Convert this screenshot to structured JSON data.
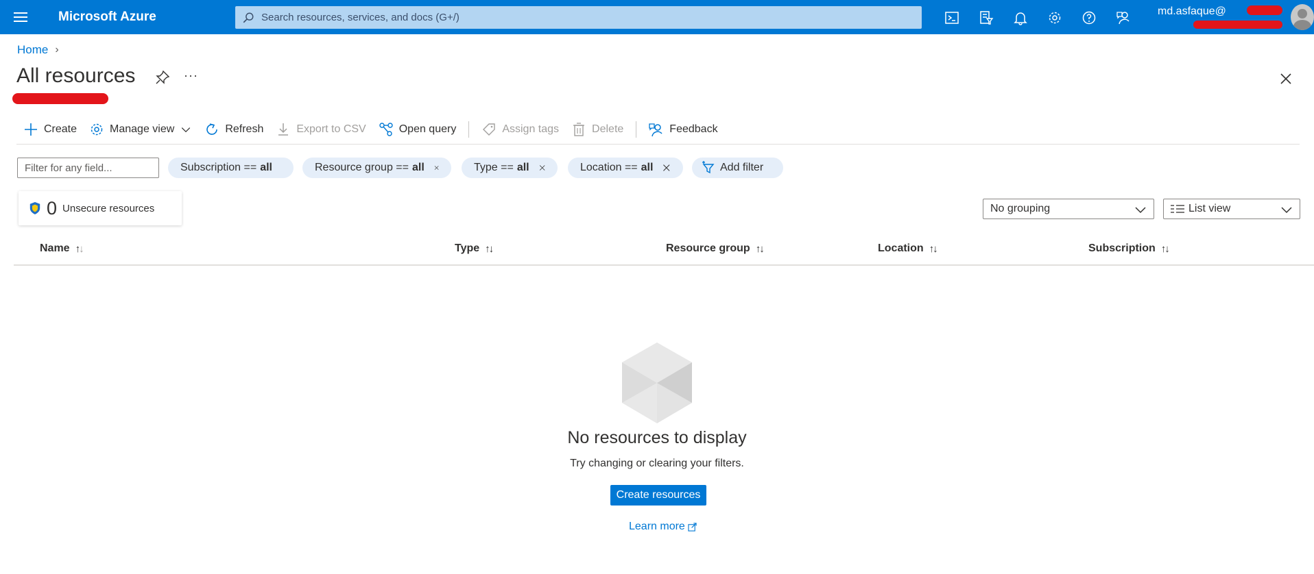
{
  "topbar": {
    "brand": "Microsoft Azure",
    "search_placeholder": "Search resources, services, and docs (G+/)",
    "user": "md.asfaque@",
    "icons": [
      "cloud-shell-icon",
      "directory-filter-icon",
      "notifications-icon",
      "settings-icon",
      "help-icon",
      "feedback-icon"
    ],
    "color": "#0078d4"
  },
  "breadcrumb": {
    "home": "Home"
  },
  "page": {
    "title": "All resources"
  },
  "toolbar": {
    "create": "Create",
    "manage_view": "Manage view",
    "refresh": "Refresh",
    "export_csv": "Export to CSV",
    "open_query": "Open query",
    "assign_tags": "Assign tags",
    "delete": "Delete",
    "feedback": "Feedback"
  },
  "filters": {
    "placeholder": "Filter for any field...",
    "subscription": {
      "label": "Subscription ==",
      "value": "all"
    },
    "resource_group": {
      "label": "Resource group ==",
      "value": "all"
    },
    "type": {
      "label": "Type ==",
      "value": "all"
    },
    "location": {
      "label": "Location ==",
      "value": "all"
    },
    "add_filter": "Add filter"
  },
  "security": {
    "count": "0",
    "label": "Unsecure resources"
  },
  "grouping": {
    "selected": "No grouping"
  },
  "view": {
    "selected": "List view"
  },
  "table": {
    "columns": [
      "Name",
      "Type",
      "Resource group",
      "Location",
      "Subscription"
    ]
  },
  "empty_state": {
    "title": "No resources to display",
    "subtitle": "Try changing or clearing your filters.",
    "button": "Create resources",
    "link": "Learn more"
  }
}
